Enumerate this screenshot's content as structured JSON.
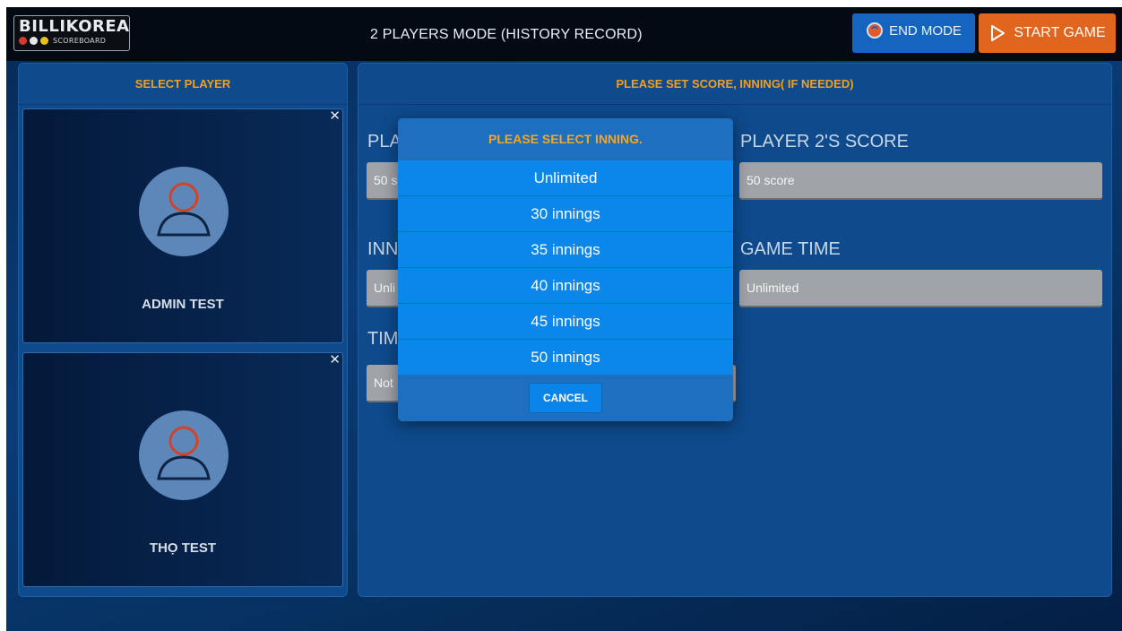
{
  "header": {
    "logo": {
      "title": "BILLIKOREA",
      "subtitle": "SCOREBOARD"
    },
    "mode_title": "2 PLAYERS MODE (HISTORY RECORD)",
    "end_mode_label": "END MODE",
    "start_game_label": "START GAME"
  },
  "left_panel": {
    "title": "SELECT PLAYER",
    "close_symbol": "✕",
    "players": [
      {
        "name": "ADMIN TEST"
      },
      {
        "name": "THỌ TEST"
      }
    ]
  },
  "right_panel": {
    "title": "PLEASE SET SCORE, INNING( IF NEEDED)",
    "player1_score": {
      "label_partial": "PLA",
      "value_partial": "50 s"
    },
    "player2_score": {
      "label": "PLAYER 2'S SCORE",
      "value": "50 score"
    },
    "inning": {
      "label_partial": "INN",
      "value_partial": "Unli"
    },
    "game_time": {
      "label": "GAME TIME",
      "value": "Unlimited"
    },
    "time": {
      "label_partial": "TIM",
      "value_partial": "Not"
    }
  },
  "modal": {
    "title": "PLEASE SELECT INNING.",
    "options": [
      "Unlimited",
      "30 innings",
      "35 innings",
      "40 innings",
      "45 innings",
      "50 innings"
    ],
    "cancel_label": "CANCEL"
  },
  "colors": {
    "accent_orange": "#f0a020",
    "start_button": "#e0651e",
    "end_button": "#1565c0",
    "option_blue": "#0b86ea",
    "avatar_ring": "#d0452a"
  }
}
